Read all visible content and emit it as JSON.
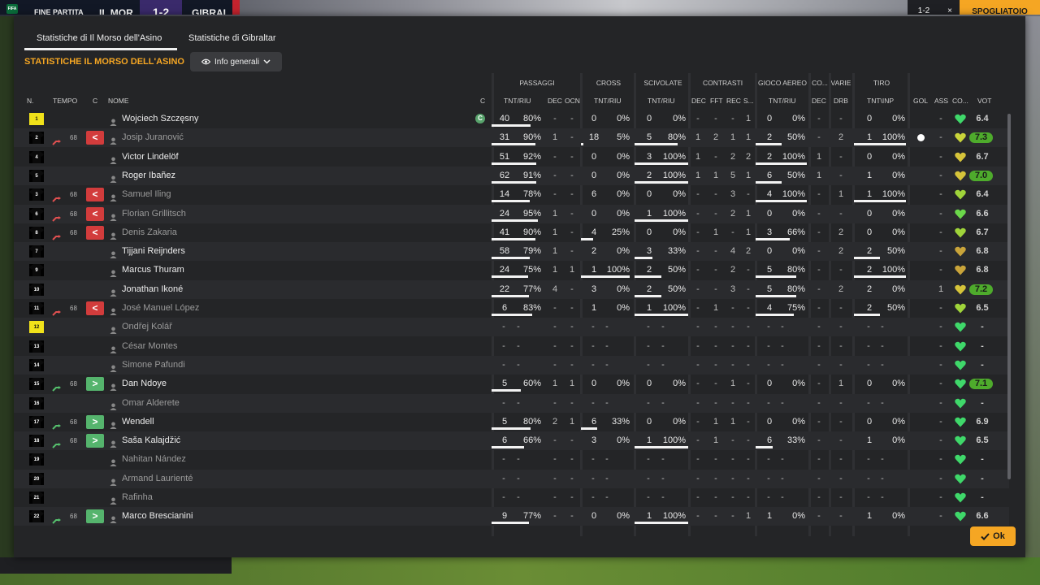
{
  "header": {
    "fine": "FINE PARTITA",
    "home": "IL MOR",
    "score": "1-2",
    "away": "GIBRAL",
    "right1": "1-2",
    "right2": "×",
    "right3": "SPOGLIATOIO",
    "logo": "FIFA"
  },
  "tabs": [
    {
      "label": "Statistiche di Il Morso dell'Asino"
    },
    {
      "label": "Statistiche di Gibraltar"
    }
  ],
  "section_title": "STATISTICHE IL MORSO DELL'ASINO",
  "view_dropdown": "Info generali",
  "ok_label": "Ok",
  "groups": {
    "passaggi": "PASSAGGI",
    "cross": "CROSS",
    "scivolate": "SCIVOLATE",
    "contrasti": "CONTRASTI",
    "aereo": "GIOCO AEREO",
    "co": "CO...",
    "varie": "VARIE",
    "tiro": "TIRO"
  },
  "cols": {
    "n": "N.",
    "tempo": "TEMPO",
    "c": "C",
    "nome": "NOME",
    "capt": "C",
    "tntriu1": "TNT/RIU",
    "dec1": "DEC",
    "ocn": "OCN",
    "tntriu2": "TNT/RIU",
    "tntriu3": "TNT/RIU",
    "dec2": "DEC",
    "fft": "FFT",
    "rec": "REC",
    "s": "S...",
    "tntriu4": "TNT/RIU",
    "dec3": "DEC",
    "drb": "DRB",
    "tntinp": "TNT\\INP",
    "gol": "GOL",
    "ass": "ASS",
    "co2": "CO...",
    "vot": "VOT"
  },
  "players": [
    {
      "n": "1",
      "shirt": "yellow",
      "sub": "",
      "min": "",
      "name": "Wojciech Szczęsny",
      "active": true,
      "capt": "C",
      "pass": [
        "40",
        "80%"
      ],
      "passbar": 0.8,
      "dec": "-",
      "ocn": "-",
      "cross": [
        "0",
        "0%"
      ],
      "crossbar": 0,
      "sciv": [
        "0",
        "0%"
      ],
      "scivbar": 0,
      "cdec": "-",
      "fft": "-",
      "rec": "-",
      "s": "1",
      "aereo": [
        "0",
        "0%"
      ],
      "aereobar": 0,
      "vdec": "-",
      "drb": "-",
      "tiro": [
        "0",
        "0%"
      ],
      "tirobar": 0,
      "gol": "",
      "ass": "-",
      "heart": "#3fd86a",
      "rating": "6.4",
      "hi": false
    },
    {
      "n": "2",
      "shirt": "black",
      "sub": "out",
      "min": "68",
      "name": "Josip Juranović",
      "active": false,
      "capt": "",
      "pass": [
        "31",
        "90%"
      ],
      "passbar": 0.9,
      "dec": "1",
      "ocn": "-",
      "cross": [
        "18",
        "5%"
      ],
      "crossbar": 0.05,
      "sciv": [
        "5",
        "80%"
      ],
      "scivbar": 0.8,
      "cdec": "1",
      "fft": "2",
      "rec": "1",
      "s": "1",
      "aereo": [
        "2",
        "50%"
      ],
      "aereobar": 0.5,
      "vdec": "-",
      "drb": "2",
      "tiro": [
        "1",
        "100%"
      ],
      "tirobar": 1,
      "gol": "ball",
      "ass": "-",
      "heart": "#c9d43a",
      "rating": "7.3",
      "hi": true
    },
    {
      "n": "4",
      "shirt": "black",
      "sub": "",
      "min": "",
      "name": "Victor Lindelöf",
      "active": true,
      "capt": "",
      "pass": [
        "51",
        "92%"
      ],
      "passbar": 0.92,
      "dec": "-",
      "ocn": "-",
      "cross": [
        "0",
        "0%"
      ],
      "crossbar": 0,
      "sciv": [
        "3",
        "100%"
      ],
      "scivbar": 1,
      "cdec": "1",
      "fft": "-",
      "rec": "2",
      "s": "2",
      "aereo": [
        "2",
        "100%"
      ],
      "aereobar": 1,
      "vdec": "1",
      "drb": "-",
      "tiro": [
        "0",
        "0%"
      ],
      "tirobar": 0,
      "gol": "",
      "ass": "-",
      "heart": "#d6c43a",
      "rating": "6.7",
      "hi": false
    },
    {
      "n": "5",
      "shirt": "black",
      "sub": "",
      "min": "",
      "name": "Roger Ibañez",
      "active": true,
      "capt": "",
      "pass": [
        "62",
        "91%"
      ],
      "passbar": 0.91,
      "dec": "-",
      "ocn": "-",
      "cross": [
        "0",
        "0%"
      ],
      "crossbar": 0,
      "sciv": [
        "2",
        "100%"
      ],
      "scivbar": 1,
      "cdec": "1",
      "fft": "1",
      "rec": "5",
      "s": "1",
      "aereo": [
        "6",
        "50%"
      ],
      "aereobar": 0.5,
      "vdec": "1",
      "drb": "-",
      "tiro": [
        "1",
        "0%"
      ],
      "tirobar": 0,
      "gol": "",
      "ass": "-",
      "heart": "#d6c43a",
      "rating": "7.0",
      "hi": true
    },
    {
      "n": "3",
      "shirt": "black",
      "sub": "out",
      "min": "68",
      "name": "Samuel Iling",
      "active": false,
      "capt": "",
      "pass": [
        "14",
        "78%"
      ],
      "passbar": 0.78,
      "dec": "-",
      "ocn": "-",
      "cross": [
        "6",
        "0%"
      ],
      "crossbar": 0,
      "sciv": [
        "0",
        "0%"
      ],
      "scivbar": 0,
      "cdec": "-",
      "fft": "-",
      "rec": "3",
      "s": "-",
      "aereo": [
        "4",
        "100%"
      ],
      "aereobar": 1,
      "vdec": "-",
      "drb": "1",
      "tiro": [
        "1",
        "100%"
      ],
      "tirobar": 1,
      "gol": "",
      "ass": "-",
      "heart": "#9fd43a",
      "rating": "6.4",
      "hi": false
    },
    {
      "n": "6",
      "shirt": "black",
      "sub": "out",
      "min": "68",
      "name": "Florian Grillitsch",
      "active": false,
      "capt": "",
      "pass": [
        "24",
        "95%"
      ],
      "passbar": 0.95,
      "dec": "1",
      "ocn": "-",
      "cross": [
        "0",
        "0%"
      ],
      "crossbar": 0,
      "sciv": [
        "1",
        "100%"
      ],
      "scivbar": 1,
      "cdec": "-",
      "fft": "-",
      "rec": "2",
      "s": "1",
      "aereo": [
        "0",
        "0%"
      ],
      "aereobar": 0,
      "vdec": "-",
      "drb": "-",
      "tiro": [
        "0",
        "0%"
      ],
      "tirobar": 0,
      "gol": "",
      "ass": "-",
      "heart": "#6bd84a",
      "rating": "6.6",
      "hi": false
    },
    {
      "n": "8",
      "shirt": "black",
      "sub": "out",
      "min": "68",
      "name": "Denis Zakaria",
      "active": false,
      "capt": "",
      "pass": [
        "41",
        "90%"
      ],
      "passbar": 0.9,
      "dec": "1",
      "ocn": "-",
      "cross": [
        "4",
        "25%"
      ],
      "crossbar": 0.25,
      "sciv": [
        "0",
        "0%"
      ],
      "scivbar": 0,
      "cdec": "-",
      "fft": "1",
      "rec": "-",
      "s": "1",
      "aereo": [
        "3",
        "66%"
      ],
      "aereobar": 0.66,
      "vdec": "-",
      "drb": "2",
      "tiro": [
        "0",
        "0%"
      ],
      "tirobar": 0,
      "gol": "",
      "ass": "-",
      "heart": "#9fd43a",
      "rating": "6.7",
      "hi": false
    },
    {
      "n": "7",
      "shirt": "black",
      "sub": "",
      "min": "",
      "name": "Tijjani Reijnders",
      "active": true,
      "capt": "",
      "pass": [
        "58",
        "79%"
      ],
      "passbar": 0.79,
      "dec": "1",
      "ocn": "-",
      "cross": [
        "2",
        "0%"
      ],
      "crossbar": 0,
      "sciv": [
        "3",
        "33%"
      ],
      "scivbar": 0.33,
      "cdec": "-",
      "fft": "-",
      "rec": "4",
      "s": "2",
      "aereo": [
        "0",
        "0%"
      ],
      "aereobar": 0,
      "vdec": "-",
      "drb": "2",
      "tiro": [
        "2",
        "50%"
      ],
      "tirobar": 0.5,
      "gol": "",
      "ass": "-",
      "heart": "#c9a43a",
      "rating": "6.8",
      "hi": false
    },
    {
      "n": "9",
      "shirt": "black",
      "sub": "",
      "min": "",
      "name": "Marcus Thuram",
      "active": true,
      "capt": "",
      "pass": [
        "24",
        "75%"
      ],
      "passbar": 0.75,
      "dec": "1",
      "ocn": "1",
      "cross": [
        "1",
        "100%"
      ],
      "crossbar": 1,
      "sciv": [
        "2",
        "50%"
      ],
      "scivbar": 0.5,
      "cdec": "-",
      "fft": "-",
      "rec": "2",
      "s": "-",
      "aereo": [
        "5",
        "80%"
      ],
      "aereobar": 0.8,
      "vdec": "-",
      "drb": "-",
      "tiro": [
        "2",
        "100%"
      ],
      "tirobar": 1,
      "gol": "",
      "ass": "-",
      "heart": "#c9a43a",
      "rating": "6.8",
      "hi": false
    },
    {
      "n": "10",
      "shirt": "black",
      "sub": "",
      "min": "",
      "name": "Jonathan Ikoné",
      "active": true,
      "capt": "",
      "pass": [
        "22",
        "77%"
      ],
      "passbar": 0.77,
      "dec": "4",
      "ocn": "-",
      "cross": [
        "3",
        "0%"
      ],
      "crossbar": 0,
      "sciv": [
        "2",
        "50%"
      ],
      "scivbar": 0.5,
      "cdec": "-",
      "fft": "-",
      "rec": "3",
      "s": "-",
      "aereo": [
        "5",
        "80%"
      ],
      "aereobar": 0.8,
      "vdec": "-",
      "drb": "2",
      "tiro": [
        "2",
        "0%"
      ],
      "tirobar": 0,
      "gol": "",
      "ass": "1",
      "heart": "#d6c43a",
      "rating": "7.2",
      "hi": true
    },
    {
      "n": "11",
      "shirt": "black",
      "sub": "out",
      "min": "68",
      "name": "José Manuel López",
      "active": false,
      "capt": "",
      "pass": [
        "6",
        "83%"
      ],
      "passbar": 0.83,
      "dec": "-",
      "ocn": "-",
      "cross": [
        "1",
        "0%"
      ],
      "crossbar": 0,
      "sciv": [
        "1",
        "100%"
      ],
      "scivbar": 1,
      "cdec": "-",
      "fft": "1",
      "rec": "-",
      "s": "-",
      "aereo": [
        "4",
        "75%"
      ],
      "aereobar": 0.75,
      "vdec": "-",
      "drb": "-",
      "tiro": [
        "2",
        "50%"
      ],
      "tirobar": 0.5,
      "gol": "",
      "ass": "-",
      "heart": "#9fd43a",
      "rating": "6.5",
      "hi": false
    },
    {
      "n": "12",
      "shirt": "yellow",
      "sub": "",
      "min": "",
      "name": "Ondřej Kolář",
      "active": false,
      "capt": "",
      "empty": true,
      "heart": "#3fd86a",
      "rating": "-",
      "hi": false
    },
    {
      "n": "13",
      "shirt": "black",
      "sub": "",
      "min": "",
      "name": "César Montes",
      "active": false,
      "capt": "",
      "empty": true,
      "heart": "#3fd86a",
      "rating": "-",
      "hi": false
    },
    {
      "n": "14",
      "shirt": "black",
      "sub": "",
      "min": "",
      "name": "Simone Pafundi",
      "active": false,
      "capt": "",
      "empty": true,
      "heart": "#3fd86a",
      "rating": "-",
      "hi": false
    },
    {
      "n": "15",
      "shirt": "black",
      "sub": "in",
      "min": "68",
      "name": "Dan Ndoye",
      "active": true,
      "capt": "",
      "pass": [
        "5",
        "60%"
      ],
      "passbar": 0.6,
      "dec": "1",
      "ocn": "1",
      "cross": [
        "0",
        "0%"
      ],
      "crossbar": 0,
      "sciv": [
        "0",
        "0%"
      ],
      "scivbar": 0,
      "cdec": "-",
      "fft": "-",
      "rec": "1",
      "s": "-",
      "aereo": [
        "0",
        "0%"
      ],
      "aereobar": 0,
      "vdec": "-",
      "drb": "1",
      "tiro": [
        "0",
        "0%"
      ],
      "tirobar": 0,
      "gol": "",
      "ass": "-",
      "heart": "#3fd86a",
      "rating": "7.1",
      "hi": true
    },
    {
      "n": "16",
      "shirt": "black",
      "sub": "",
      "min": "",
      "name": "Omar Alderete",
      "active": false,
      "capt": "",
      "empty": true,
      "heart": "#3fd86a",
      "rating": "-",
      "hi": false
    },
    {
      "n": "17",
      "shirt": "black",
      "sub": "in",
      "min": "68",
      "name": "Wendell",
      "active": true,
      "capt": "",
      "pass": [
        "5",
        "80%"
      ],
      "passbar": 0.8,
      "dec": "2",
      "ocn": "1",
      "cross": [
        "6",
        "33%"
      ],
      "crossbar": 0.33,
      "sciv": [
        "0",
        "0%"
      ],
      "scivbar": 0,
      "cdec": "-",
      "fft": "1",
      "rec": "1",
      "s": "-",
      "aereo": [
        "0",
        "0%"
      ],
      "aereobar": 0,
      "vdec": "-",
      "drb": "-",
      "tiro": [
        "0",
        "0%"
      ],
      "tirobar": 0,
      "gol": "",
      "ass": "-",
      "heart": "#3fd86a",
      "rating": "6.9",
      "hi": false
    },
    {
      "n": "18",
      "shirt": "black",
      "sub": "in",
      "min": "68",
      "name": "Saša Kalajdžić",
      "active": true,
      "capt": "",
      "pass": [
        "6",
        "66%"
      ],
      "passbar": 0.66,
      "dec": "-",
      "ocn": "-",
      "cross": [
        "3",
        "0%"
      ],
      "crossbar": 0,
      "sciv": [
        "1",
        "100%"
      ],
      "scivbar": 1,
      "cdec": "-",
      "fft": "1",
      "rec": "-",
      "s": "-",
      "aereo": [
        "6",
        "33%"
      ],
      "aereobar": 0.33,
      "vdec": "-",
      "drb": "-",
      "tiro": [
        "1",
        "0%"
      ],
      "tirobar": 0,
      "gol": "",
      "ass": "-",
      "heart": "#3fd86a",
      "rating": "6.5",
      "hi": false
    },
    {
      "n": "19",
      "shirt": "black",
      "sub": "",
      "min": "",
      "name": "Nahitan Nández",
      "active": false,
      "capt": "",
      "empty": true,
      "heart": "#3fd86a",
      "rating": "-",
      "hi": false
    },
    {
      "n": "20",
      "shirt": "black",
      "sub": "",
      "min": "",
      "name": "Armand Laurienté",
      "active": false,
      "capt": "",
      "empty": true,
      "heart": "#3fd86a",
      "rating": "-",
      "hi": false
    },
    {
      "n": "21",
      "shirt": "black",
      "sub": "",
      "min": "",
      "name": "Rafinha",
      "active": false,
      "capt": "",
      "empty": true,
      "heart": "#3fd86a",
      "rating": "-",
      "hi": false
    },
    {
      "n": "22",
      "shirt": "black",
      "sub": "in",
      "min": "68",
      "name": "Marco Brescianini",
      "active": true,
      "capt": "",
      "pass": [
        "9",
        "77%"
      ],
      "passbar": 0.77,
      "dec": "-",
      "ocn": "-",
      "cross": [
        "0",
        "0%"
      ],
      "crossbar": 0,
      "sciv": [
        "1",
        "100%"
      ],
      "scivbar": 1,
      "cdec": "-",
      "fft": "-",
      "rec": "-",
      "s": "1",
      "aereo": [
        "1",
        "0%"
      ],
      "aereobar": 0,
      "vdec": "-",
      "drb": "-",
      "tiro": [
        "1",
        "0%"
      ],
      "tirobar": 0,
      "gol": "",
      "ass": "-",
      "heart": "#3fd86a",
      "rating": "6.6",
      "hi": false
    }
  ]
}
